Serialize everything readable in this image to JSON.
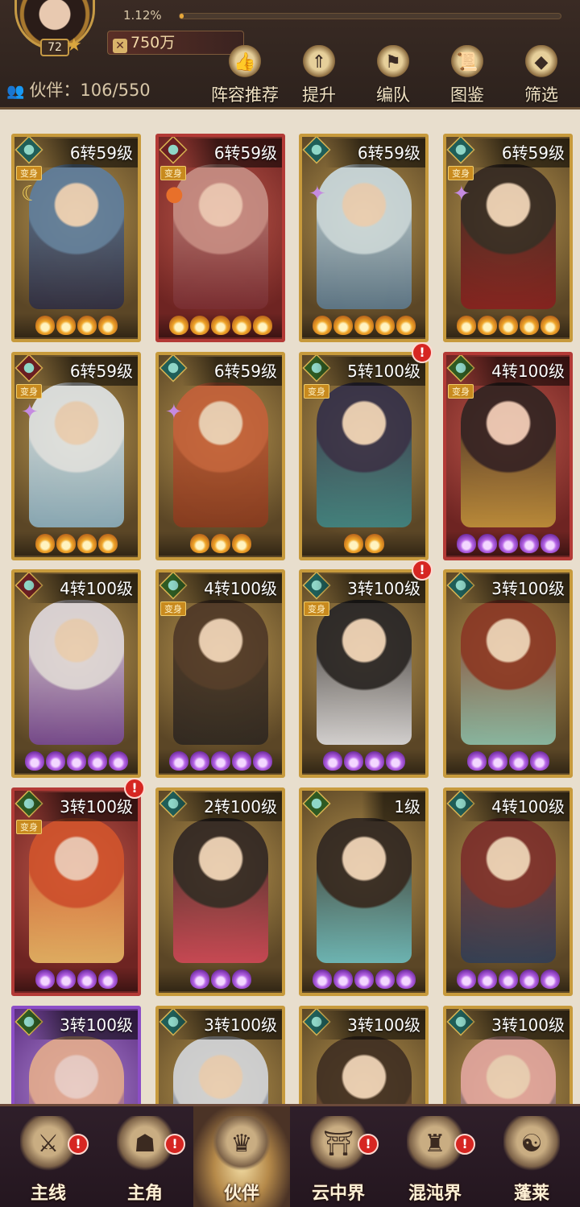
{
  "header": {
    "avatar_level": "72",
    "exp_text": "1.12%",
    "exp_progress": 0.0112,
    "power": "750万",
    "partner_label": "伙伴：106/550",
    "menu": [
      {
        "label": "阵容推荐",
        "icon": "thumbs-up-icon"
      },
      {
        "label": "提升",
        "icon": "upgrade-arrow-icon"
      },
      {
        "label": "编队",
        "icon": "formation-flag-icon"
      },
      {
        "label": "图鉴",
        "icon": "scroll-book-icon"
      },
      {
        "label": "筛选",
        "icon": "filter-diamond-icon"
      }
    ]
  },
  "transform_tag": "变身",
  "badge_text": "!",
  "cards": [
    {
      "level": "6转59级",
      "frame": "gold",
      "element": "teal",
      "transform": true,
      "stars": 4,
      "star_color": "orange",
      "side_icon": "moon",
      "notify": false,
      "palette": [
        "#5b7fa6",
        "#2c2c44"
      ]
    },
    {
      "level": "6转59级",
      "frame": "red",
      "element": "red",
      "transform": true,
      "stars": 5,
      "star_color": "orange",
      "side_icon": "orb",
      "notify": false,
      "palette": [
        "#c9948a",
        "#7a2f33"
      ]
    },
    {
      "level": "6转59级",
      "frame": "gold",
      "element": "teal",
      "transform": false,
      "stars": 5,
      "star_color": "orange",
      "side_icon": "star",
      "notify": false,
      "palette": [
        "#cfe2ec",
        "#5d7c93"
      ]
    },
    {
      "level": "6转59级",
      "frame": "gold",
      "element": "teal",
      "transform": true,
      "stars": 5,
      "star_color": "orange",
      "side_icon": "star",
      "notify": false,
      "palette": [
        "#2d2320",
        "#8b1e1e"
      ]
    },
    {
      "level": "6转59级",
      "frame": "gold",
      "element": "red",
      "transform": true,
      "stars": 4,
      "star_color": "orange",
      "side_icon": "star",
      "notify": false,
      "palette": [
        "#e7eef4",
        "#8fb6c9"
      ]
    },
    {
      "level": "6转59级",
      "frame": "gold",
      "element": "teal",
      "transform": false,
      "stars": 3,
      "star_color": "orange",
      "side_icon": "star",
      "notify": false,
      "palette": [
        "#c8603a",
        "#8c3a1e"
      ]
    },
    {
      "level": "5转100级",
      "frame": "gold",
      "element": "green",
      "transform": true,
      "stars": 2,
      "star_color": "orange",
      "side_icon": "",
      "notify": true,
      "palette": [
        "#2d2b4a",
        "#3e8a8a"
      ]
    },
    {
      "level": "4转100级",
      "frame": "red",
      "element": "green",
      "transform": true,
      "stars": 5,
      "star_color": "purple",
      "side_icon": "",
      "notify": false,
      "palette": [
        "#2a2220",
        "#c59a3c"
      ]
    },
    {
      "level": "4转100级",
      "frame": "gold",
      "element": "red",
      "transform": false,
      "stars": 5,
      "star_color": "purple",
      "side_icon": "",
      "notify": false,
      "palette": [
        "#e6e1ea",
        "#7a4a9a"
      ]
    },
    {
      "level": "4转100级",
      "frame": "gold",
      "element": "green",
      "transform": true,
      "stars": 5,
      "star_color": "purple",
      "side_icon": "",
      "notify": false,
      "palette": [
        "#4a3426",
        "#2b2520"
      ]
    },
    {
      "level": "3转100级",
      "frame": "gold",
      "element": "teal",
      "transform": true,
      "stars": 4,
      "star_color": "purple",
      "side_icon": "",
      "notify": true,
      "palette": [
        "#202026",
        "#e6e6ea"
      ]
    },
    {
      "level": "3转100级",
      "frame": "gold",
      "element": "teal",
      "transform": false,
      "stars": 4,
      "star_color": "purple",
      "side_icon": "",
      "notify": false,
      "palette": [
        "#8a3424",
        "#8fc7b2"
      ]
    },
    {
      "level": "3转100级",
      "frame": "red",
      "element": "green",
      "transform": true,
      "stars": 4,
      "star_color": "purple",
      "side_icon": "",
      "notify": true,
      "palette": [
        "#d5562c",
        "#f0c26a"
      ]
    },
    {
      "level": "2转100级",
      "frame": "gold",
      "element": "teal",
      "transform": false,
      "stars": 3,
      "star_color": "purple",
      "side_icon": "",
      "notify": false,
      "palette": [
        "#2b2222",
        "#d8485a"
      ]
    },
    {
      "level": "1级",
      "frame": "gold",
      "element": "green",
      "transform": false,
      "stars": 5,
      "star_color": "purple",
      "side_icon": "",
      "notify": false,
      "palette": [
        "#2a2220",
        "#6fc6c9"
      ]
    },
    {
      "level": "4转100级",
      "frame": "gold",
      "element": "teal",
      "transform": false,
      "stars": 5,
      "star_color": "purple",
      "side_icon": "",
      "notify": false,
      "palette": [
        "#7a2a2a",
        "#2e3e5a"
      ]
    },
    {
      "level": "3转100级",
      "frame": "purple",
      "element": "green",
      "transform": false,
      "stars": 0,
      "star_color": "purple",
      "side_icon": "",
      "notify": false,
      "palette": [
        "#e9b08a",
        "#6a3a8a"
      ]
    },
    {
      "level": "3转100级",
      "frame": "gold",
      "element": "teal",
      "transform": false,
      "stars": 0,
      "star_color": "purple",
      "side_icon": "",
      "notify": false,
      "palette": [
        "#d8dde6",
        "#5a6a8a"
      ]
    },
    {
      "level": "3转100级",
      "frame": "gold",
      "element": "teal",
      "transform": false,
      "stars": 0,
      "star_color": "purple",
      "side_icon": "",
      "notify": false,
      "palette": [
        "#3a2a20",
        "#8a5a3a"
      ]
    },
    {
      "level": "3转100级",
      "frame": "gold",
      "element": "teal",
      "transform": false,
      "stars": 0,
      "star_color": "purple",
      "side_icon": "",
      "notify": false,
      "palette": [
        "#e8aaa6",
        "#3a3a4a"
      ]
    }
  ],
  "bottom_nav": [
    {
      "label": "主线",
      "icon": "crossed-swords-icon",
      "notify": true,
      "active": false
    },
    {
      "label": "主角",
      "icon": "hero-helmet-icon",
      "notify": true,
      "active": false
    },
    {
      "label": "伙伴",
      "icon": "partner-helmet-icon",
      "notify": false,
      "active": true
    },
    {
      "label": "云中界",
      "icon": "pagoda-icon",
      "notify": true,
      "active": false
    },
    {
      "label": "混沌界",
      "icon": "chaos-totem-icon",
      "notify": true,
      "active": false
    },
    {
      "label": "蓬莱",
      "icon": "immortal-sage-icon",
      "notify": false,
      "active": false
    }
  ]
}
